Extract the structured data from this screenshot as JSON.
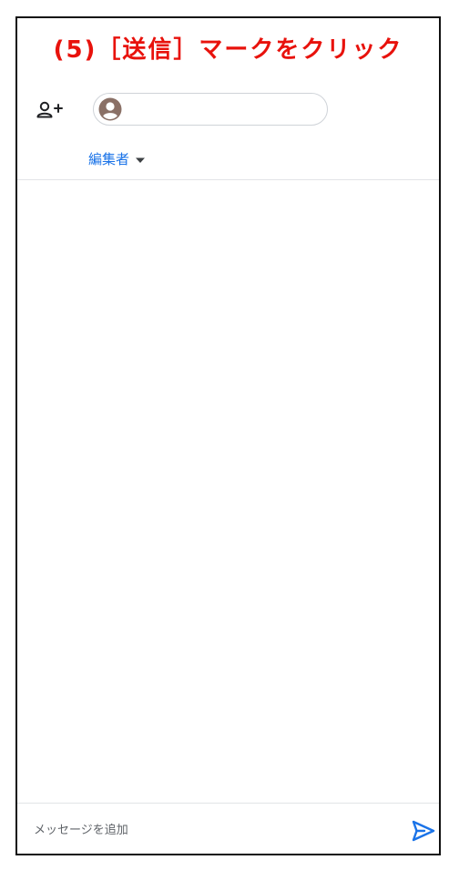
{
  "instruction": {
    "text": "(5)［送信］マークをクリック",
    "color": "#e8120c"
  },
  "recipients": {
    "add_icon": "person-add-icon",
    "avatar_icon": "account-circle-icon",
    "value": ""
  },
  "role": {
    "selected": "編集者",
    "icon": "caret-down-icon",
    "color": "#1a73e8"
  },
  "message": {
    "placeholder": "メッセージを追加",
    "value": ""
  },
  "send": {
    "icon": "send-icon",
    "color": "#1a73e8"
  }
}
